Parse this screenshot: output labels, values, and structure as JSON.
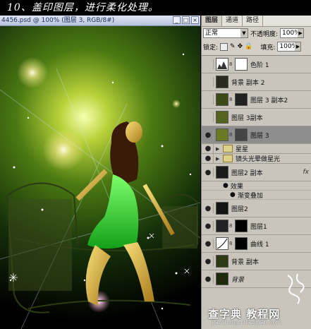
{
  "step_title": "10、盖印图层，进行柔化处理。",
  "document": {
    "title": "4456.psd @ 100% (图层 3, RGB/8#)",
    "buttons": [
      "_",
      "□",
      "×"
    ]
  },
  "layers_panel": {
    "tabs": [
      "图层",
      "通道",
      "路径"
    ],
    "blend_mode": "正常",
    "opacity_label": "不透明度:",
    "opacity_value": "100%",
    "lock_label": "锁定:",
    "fill_label": "填充:",
    "fill_value": "100%",
    "layers": [
      {
        "name": "色阶 1",
        "visible": false
      },
      {
        "name": "背景 副本 2",
        "visible": false
      },
      {
        "name": "图层 3 副本2",
        "visible": false
      },
      {
        "name": "图层 3副本",
        "visible": false
      },
      {
        "name": "图层 3",
        "visible": true,
        "active": true
      },
      {
        "name": "星星",
        "visible": true,
        "group": true
      },
      {
        "name": "镜头光晕做星光",
        "visible": true,
        "group": true
      },
      {
        "name": "图层2 副本",
        "visible": true,
        "fx": "fx"
      },
      {
        "name": "效果",
        "sub": true
      },
      {
        "name": "渐变叠加",
        "sub": true
      },
      {
        "name": "图层2",
        "visible": true
      },
      {
        "name": "图层1",
        "visible": true
      },
      {
        "name": "曲线 1",
        "visible": true
      },
      {
        "name": "背景 副本",
        "visible": true
      },
      {
        "name": "背景",
        "visible": true
      }
    ]
  },
  "watermark": {
    "text": "查字典 教程网",
    "url": "jiaocheng.chazidian.com"
  },
  "colors": {
    "panel": "#d4d0c8",
    "active_layer": "#8e8e8e"
  }
}
